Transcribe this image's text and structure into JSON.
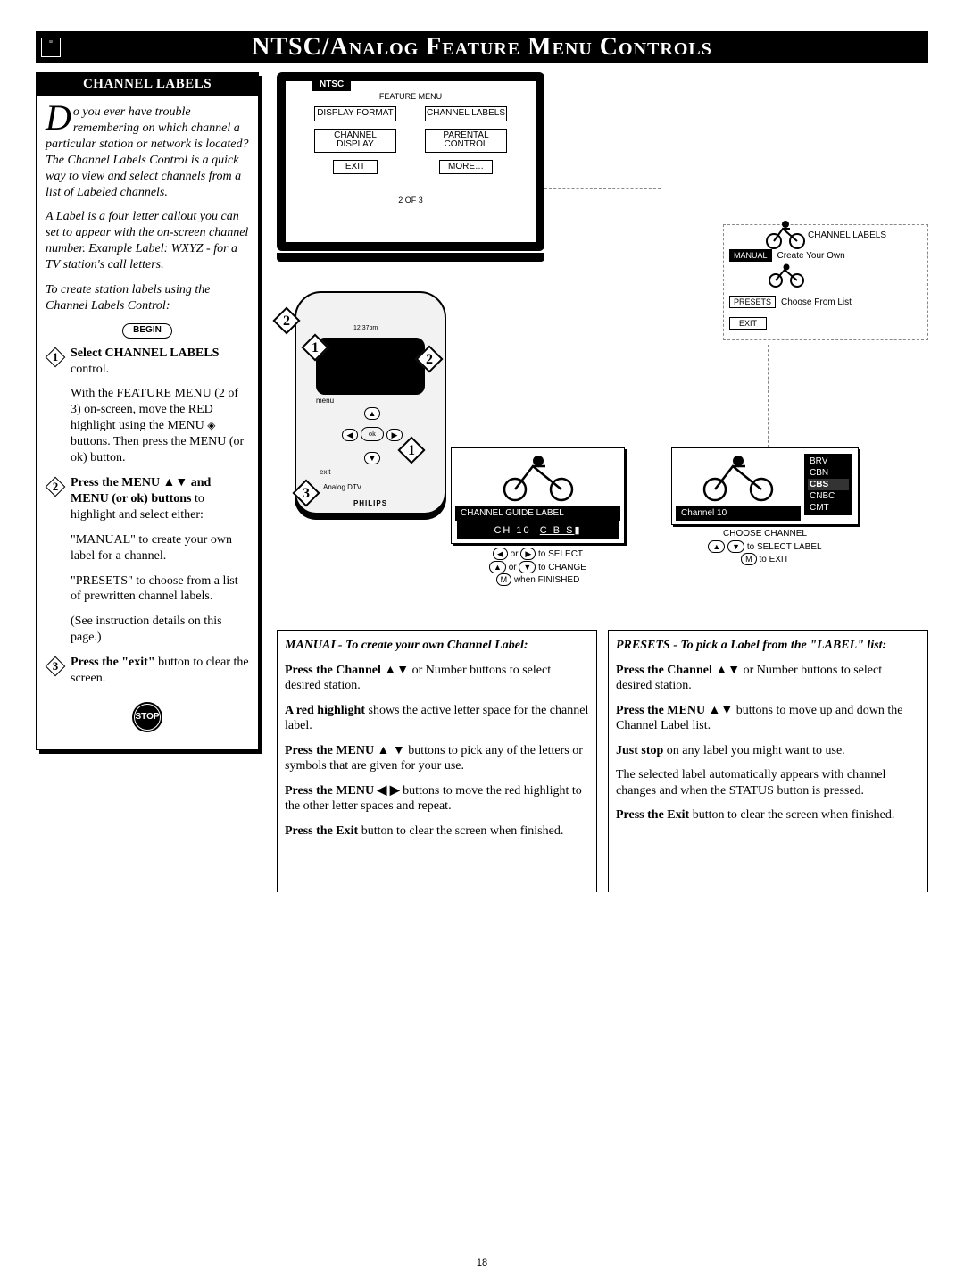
{
  "banner": {
    "title": "NTSC/Analog Feature Menu Controls"
  },
  "sidebar": {
    "header": "CHANNEL LABELS",
    "dropcap": "D",
    "intro_rest": "o you ever have trouble remembering on which channel a particular station or network is located? The Channel Labels Control is a quick way to view and select channels from a list of Labeled channels.",
    "para2": "A Label is a four letter callout you can set to appear with the on-screen channel number. Example Label: WXYZ - for a TV station's call letters.",
    "para3": "To create station labels using the Channel Labels Control:",
    "begin": "BEGIN",
    "step1_bold": "Select CHANNEL LABELS",
    "step1_rest": " control.",
    "step1_body_a": "With the FEATURE MENU (2 of 3) on-screen, move the RED highlight using the MENU ",
    "step1_body_b": " buttons. Then press the MENU (or ok) button.",
    "step2_bold": "Press the MENU ▲▼ and MENU (or ok) buttons",
    "step2_rest": " to highlight and select either:",
    "step2_body1": "\"MANUAL\" to create your own label for a channel.",
    "step2_body2": "\"PRESETS\" to choose from a list of prewritten channel labels.",
    "step2_body3": "(See instruction details on this page.)",
    "step3_bold": "Press the \"exit\"",
    "step3_rest": " button to clear the screen.",
    "stop": "STOP"
  },
  "tv": {
    "ntsc": "NTSC",
    "feature_menu": "FEATURE MENU",
    "cells": {
      "c1": "DISPLAY FORMAT",
      "c2": "CHANNEL LABELS",
      "c3": "CHANNEL DISPLAY",
      "c4": "PARENTAL CONTROL",
      "c5": "EXIT",
      "c6": "MORE…"
    },
    "pager": "2 OF 3"
  },
  "remote": {
    "time": "12:37pm",
    "menu": "menu",
    "exit": "exit",
    "ok": "ok",
    "brand": "PHILIPS",
    "mode": "Analog      DTV"
  },
  "submenu": {
    "title": "CHANNEL LABELS",
    "manual": "MANUAL",
    "manual_desc": "Create Your Own",
    "presets": "PRESETS",
    "presets_desc": "Choose From List",
    "exit": "EXIT"
  },
  "panelA": {
    "bar1": "CHANNEL GUIDE LABEL",
    "bar2_ch": "CH 10",
    "bar2_lbl": "C B S",
    "hint1a": "◀  or  ▶  to SELECT",
    "hint2a": "▲  or  ▼  to CHANGE",
    "hint3a": "M  when FINISHED"
  },
  "panelB": {
    "chan": "Channel    10",
    "list": [
      "BRV",
      "CBN",
      "CBS",
      "CNBC",
      "CMT"
    ],
    "selected_index": 2,
    "hint_choose": "CHOOSE CHANNEL",
    "hint_select": "▲  ▼  to SELECT LABEL",
    "hint_exit": "M  to EXIT"
  },
  "instr": {
    "manual_head": "MANUAL- To create your own Channel Label:",
    "m1_b": "Press the Channel ▲▼",
    "m1_r": " or Number buttons to select desired station.",
    "m2_b": "A red highlight",
    "m2_r": " shows the active letter space for the channel label.",
    "m3_b": "Press the MENU ▲ ▼",
    "m3_r": " buttons to pick any of the letters or symbols that are given for your use.",
    "m4_b": "Press the MENU ◀ ▶",
    "m4_r": " buttons to move the red highlight to the other letter spaces and repeat.",
    "m5_b": "Press the Exit",
    "m5_r": " button to clear the screen when finished.",
    "presets_head": "PRESETS - To pick a Label from the \"LABEL\" list:",
    "p1_b": "Press the Channel ▲▼",
    "p1_r": " or Number buttons to select desired station.",
    "p2_b": "Press the MENU ▲▼",
    "p2_r": " buttons to move up and down the Channel Label list.",
    "p3_b": "Just stop",
    "p3_r": " on any label you might want to use.",
    "p4": "The selected label automatically appears with channel changes and when the STATUS button is pressed.",
    "p5_b": "Press the Exit",
    "p5_r": " button to clear the screen when finished."
  },
  "pagenum": "18"
}
